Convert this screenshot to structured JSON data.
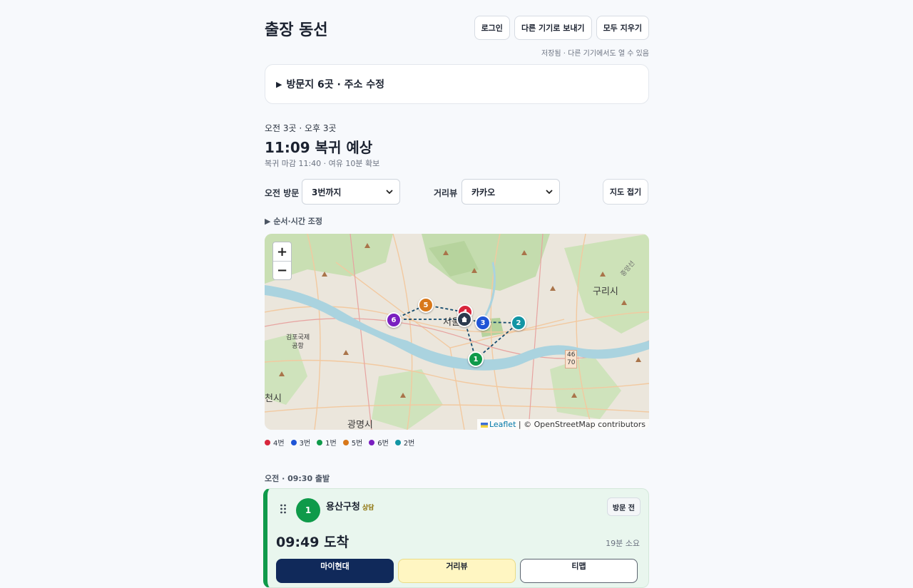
{
  "header": {
    "title": "출장 동선",
    "login_label": "로그인",
    "send_label": "다른 기기로 보내기",
    "clear_label": "모두 지우기",
    "save_note": "저장됨 · 다른 기기에서도 열 수 있음"
  },
  "visits_toggle": {
    "arrow": "▶",
    "label": "방문지 6곳 · 주소 수정"
  },
  "summary": {
    "split": "오전 3곳 · 오후 3곳",
    "return_title": "11:09 복귀 예상",
    "deadline": "복귀 마감 11:40 · 여유 10분 확보"
  },
  "controls": {
    "morning_label": "오전 방문",
    "morning_value": "3번까지",
    "distance_label": "거리뷰",
    "distance_value": "카카오",
    "fold_label": "지도 접기"
  },
  "reorder": {
    "arrow": "▶",
    "label": "순서·시간 조정"
  },
  "map": {
    "zoom_in": "+",
    "zoom_out": "−",
    "attribution_leaflet": "Leaflet",
    "attribution_rest": " | © OpenStreetMap contributors",
    "labels": {
      "guri": "구리시",
      "gimpo": "김포국제\n공항",
      "gwangmyeong": "광명시",
      "bucheon": "천시",
      "seoul": "서울",
      "route": "46\n70",
      "jungang": "중앙선"
    },
    "pins": [
      {
        "num": "1",
        "color": "#0f9a4a"
      },
      {
        "num": "2",
        "color": "#1295a4"
      },
      {
        "num": "3",
        "color": "#1f55d6"
      },
      {
        "num": "4",
        "color": "#d8263c"
      },
      {
        "num": "5",
        "color": "#d8781a"
      },
      {
        "num": "6",
        "color": "#7a1fc0"
      }
    ],
    "home_icon": "home-icon"
  },
  "legend": [
    {
      "label": "4번",
      "color": "#d8263c"
    },
    {
      "label": "3번",
      "color": "#1f55d6"
    },
    {
      "label": "1번",
      "color": "#0f9a4a"
    },
    {
      "label": "5번",
      "color": "#d8781a"
    },
    {
      "label": "6번",
      "color": "#7a1fc0"
    },
    {
      "label": "2번",
      "color": "#1295a4"
    }
  ],
  "schedule": {
    "section_head": "오전 · 09:30 출발",
    "stops": [
      {
        "num": "1",
        "name": "용산구청",
        "tag": "상담",
        "status": "방문 전",
        "arrive": "09:49 도착",
        "duration": "19분 소요",
        "nav1": "마이현대",
        "nav2": "거리뷰",
        "nav3": "티맵"
      }
    ]
  }
}
